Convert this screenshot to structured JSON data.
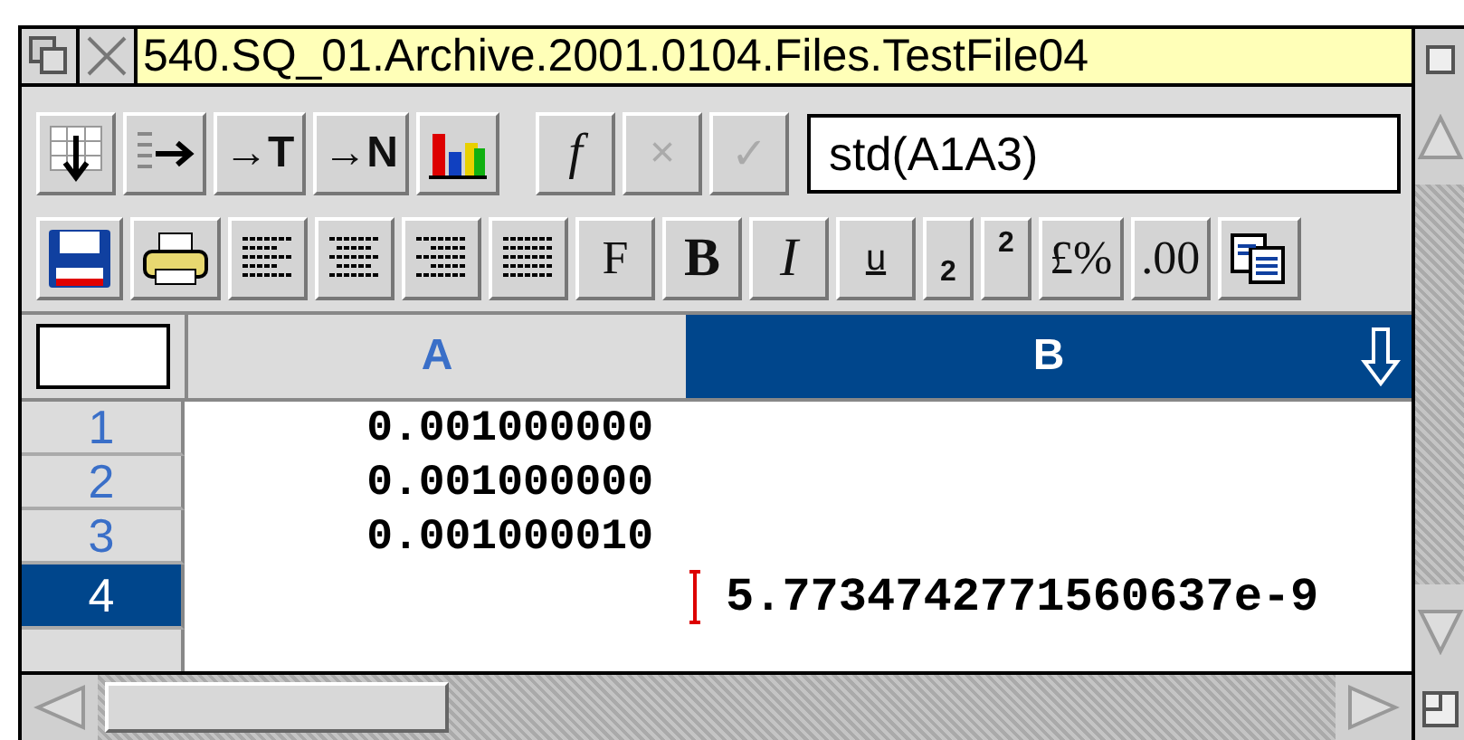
{
  "window": {
    "title": "540.SQ_01.Archive.2001.0104.Files.TestFile04"
  },
  "toolbar_rows": [
    [
      {
        "kind": "icon"
      },
      {
        "kind": "icon"
      },
      {
        "kind": "text",
        "label": "→T"
      },
      {
        "kind": "text",
        "label": "→N"
      },
      {
        "kind": "icon"
      },
      {
        "kind": "gap"
      },
      {
        "kind": "text",
        "label": "f",
        "disabled": false
      },
      {
        "kind": "text",
        "label": "×",
        "disabled": true
      },
      {
        "kind": "text",
        "label": "✓",
        "disabled": true
      }
    ],
    [
      {
        "kind": "icon"
      },
      {
        "kind": "icon"
      },
      {
        "kind": "icon"
      },
      {
        "kind": "icon"
      },
      {
        "kind": "icon"
      },
      {
        "kind": "icon"
      },
      {
        "kind": "text",
        "label": "F"
      },
      {
        "kind": "text",
        "label": "B"
      },
      {
        "kind": "text",
        "label": "I"
      },
      {
        "kind": "text",
        "label": "u"
      },
      {
        "kind": "text",
        "label": "2"
      },
      {
        "kind": "text",
        "label": "2"
      },
      {
        "kind": "text",
        "label": "£%"
      },
      {
        "kind": "text",
        "label": ".00"
      },
      {
        "kind": "icon"
      }
    ]
  ],
  "formula": {
    "value": "std(A1A3)"
  },
  "columns": [
    {
      "label": "A",
      "selected": false
    },
    {
      "label": "B",
      "selected": true
    }
  ],
  "rows": [
    {
      "label": "1",
      "selected": false,
      "column_a": "0.001000000"
    },
    {
      "label": "2",
      "selected": false,
      "column_a": "0.001000000"
    },
    {
      "label": "3",
      "selected": false,
      "column_a": "0.001000010"
    },
    {
      "label": "4",
      "selected": true,
      "column_b": "5.7734742771560637e-9"
    }
  ]
}
